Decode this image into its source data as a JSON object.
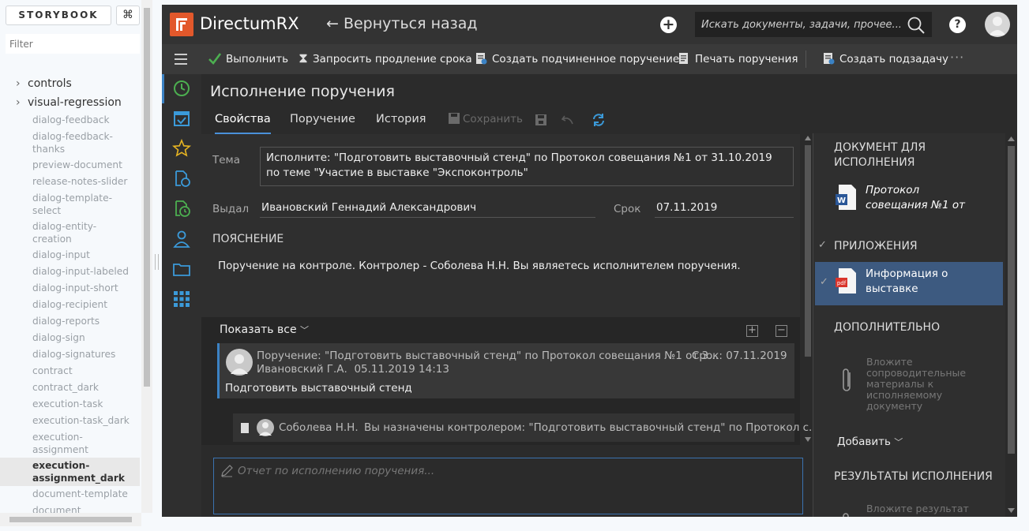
{
  "storybook": {
    "brand": "STORYBOOK",
    "shortcut": "⌘",
    "filter_placeholder": "Filter",
    "folders": [
      {
        "label": "controls"
      },
      {
        "label": "visual-regression"
      }
    ],
    "items": [
      {
        "label": "dialog-feedback"
      },
      {
        "label": "dialog-feedback-thanks"
      },
      {
        "label": "preview-document"
      },
      {
        "label": "release-notes-slider"
      },
      {
        "label": "dialog-template-select"
      },
      {
        "label": "dialog-entity-creation"
      },
      {
        "label": "dialog-input"
      },
      {
        "label": "dialog-input-labeled"
      },
      {
        "label": "dialog-input-short"
      },
      {
        "label": "dialog-recipient"
      },
      {
        "label": "dialog-reports"
      },
      {
        "label": "dialog-sign"
      },
      {
        "label": "dialog-signatures"
      },
      {
        "label": "contract"
      },
      {
        "label": "contract_dark"
      },
      {
        "label": "execution-task"
      },
      {
        "label": "execution-task_dark"
      },
      {
        "label": "execution-assignment"
      },
      {
        "label": "execution-assignment_dark"
      },
      {
        "label": "document-template"
      },
      {
        "label": "document"
      }
    ]
  },
  "app": {
    "logo_text": "DirectumRX",
    "back_label": "← Вернуться назад",
    "search_placeholder": "Искать документы, задачи, прочее...",
    "help_label": "?",
    "toolbar": {
      "execute": "Выполнить",
      "extend": "Запросить продление срока",
      "create_sub": "Создать подчиненное поручение",
      "print": "Печать поручения",
      "create_subtask": "Создать подзадачу",
      "more": "···"
    },
    "title": "Исполнение поручения",
    "tabs": {
      "props": "Свойства",
      "assignment": "Поручение",
      "history": "История",
      "save": "Сохранить"
    },
    "fields": {
      "subject_label": "Тема",
      "subject_value": "Исполните: \"Подготовить выставочный стенд\" по Протокол совещания №1 от 31.10.2019 по теме \"Участие в выставке \"Экспоконтроль\"",
      "issued_label": "Выдал",
      "issued_value": "Ивановский Геннадий Александрович",
      "due_label": "Срок",
      "due_value": "07.11.2019"
    },
    "explanation_head": "ПОЯСНЕНИЕ",
    "explanation_text": "Поручение на контроле. Контролер - Соболева Н.Н. Вы являетесь исполнителем поручения.",
    "thread": {
      "show_all": "Показать все",
      "expand": "+",
      "collapse": "−",
      "message": {
        "subject": "Поручение: \"Подготовить выставочный стенд\" по Протокол совещания №1 от 3...",
        "due": "Срок: 07.11.2019",
        "author": "Ивановский Г.А.",
        "datetime": "05.11.2019 14:13",
        "body": "Подготовить выставочный стенд"
      },
      "reply": {
        "author": "Соболева Н.Н.",
        "text": "Вы назначены контролером: \"Подготовить выставочный стенд\" по Протокол с..."
      }
    },
    "report_placeholder": "Отчет по исполнению поручения...",
    "right": {
      "doc_head": "ДОКУМЕНТ ДЛЯ ИСПОЛНЕНИЯ",
      "doc_file": "Протокол совещания №1 от",
      "attach_head": "ПРИЛОЖЕНИЯ",
      "attach_file": "Информация о выставке",
      "extra_head": "ДОПОЛНИТЕЛЬНО",
      "extra_hint": "Вложите сопроводительные материалы к исполняемому документу",
      "add_label": "Добавить",
      "results_head": "РЕЗУЛЬТАТЫ ИСПОЛНЕНИЯ",
      "results_hint": "Вложите результат исполнения"
    },
    "colors": {
      "accent": "#3b82c4",
      "brand": "#e2582b",
      "check": "#4caf50"
    }
  }
}
